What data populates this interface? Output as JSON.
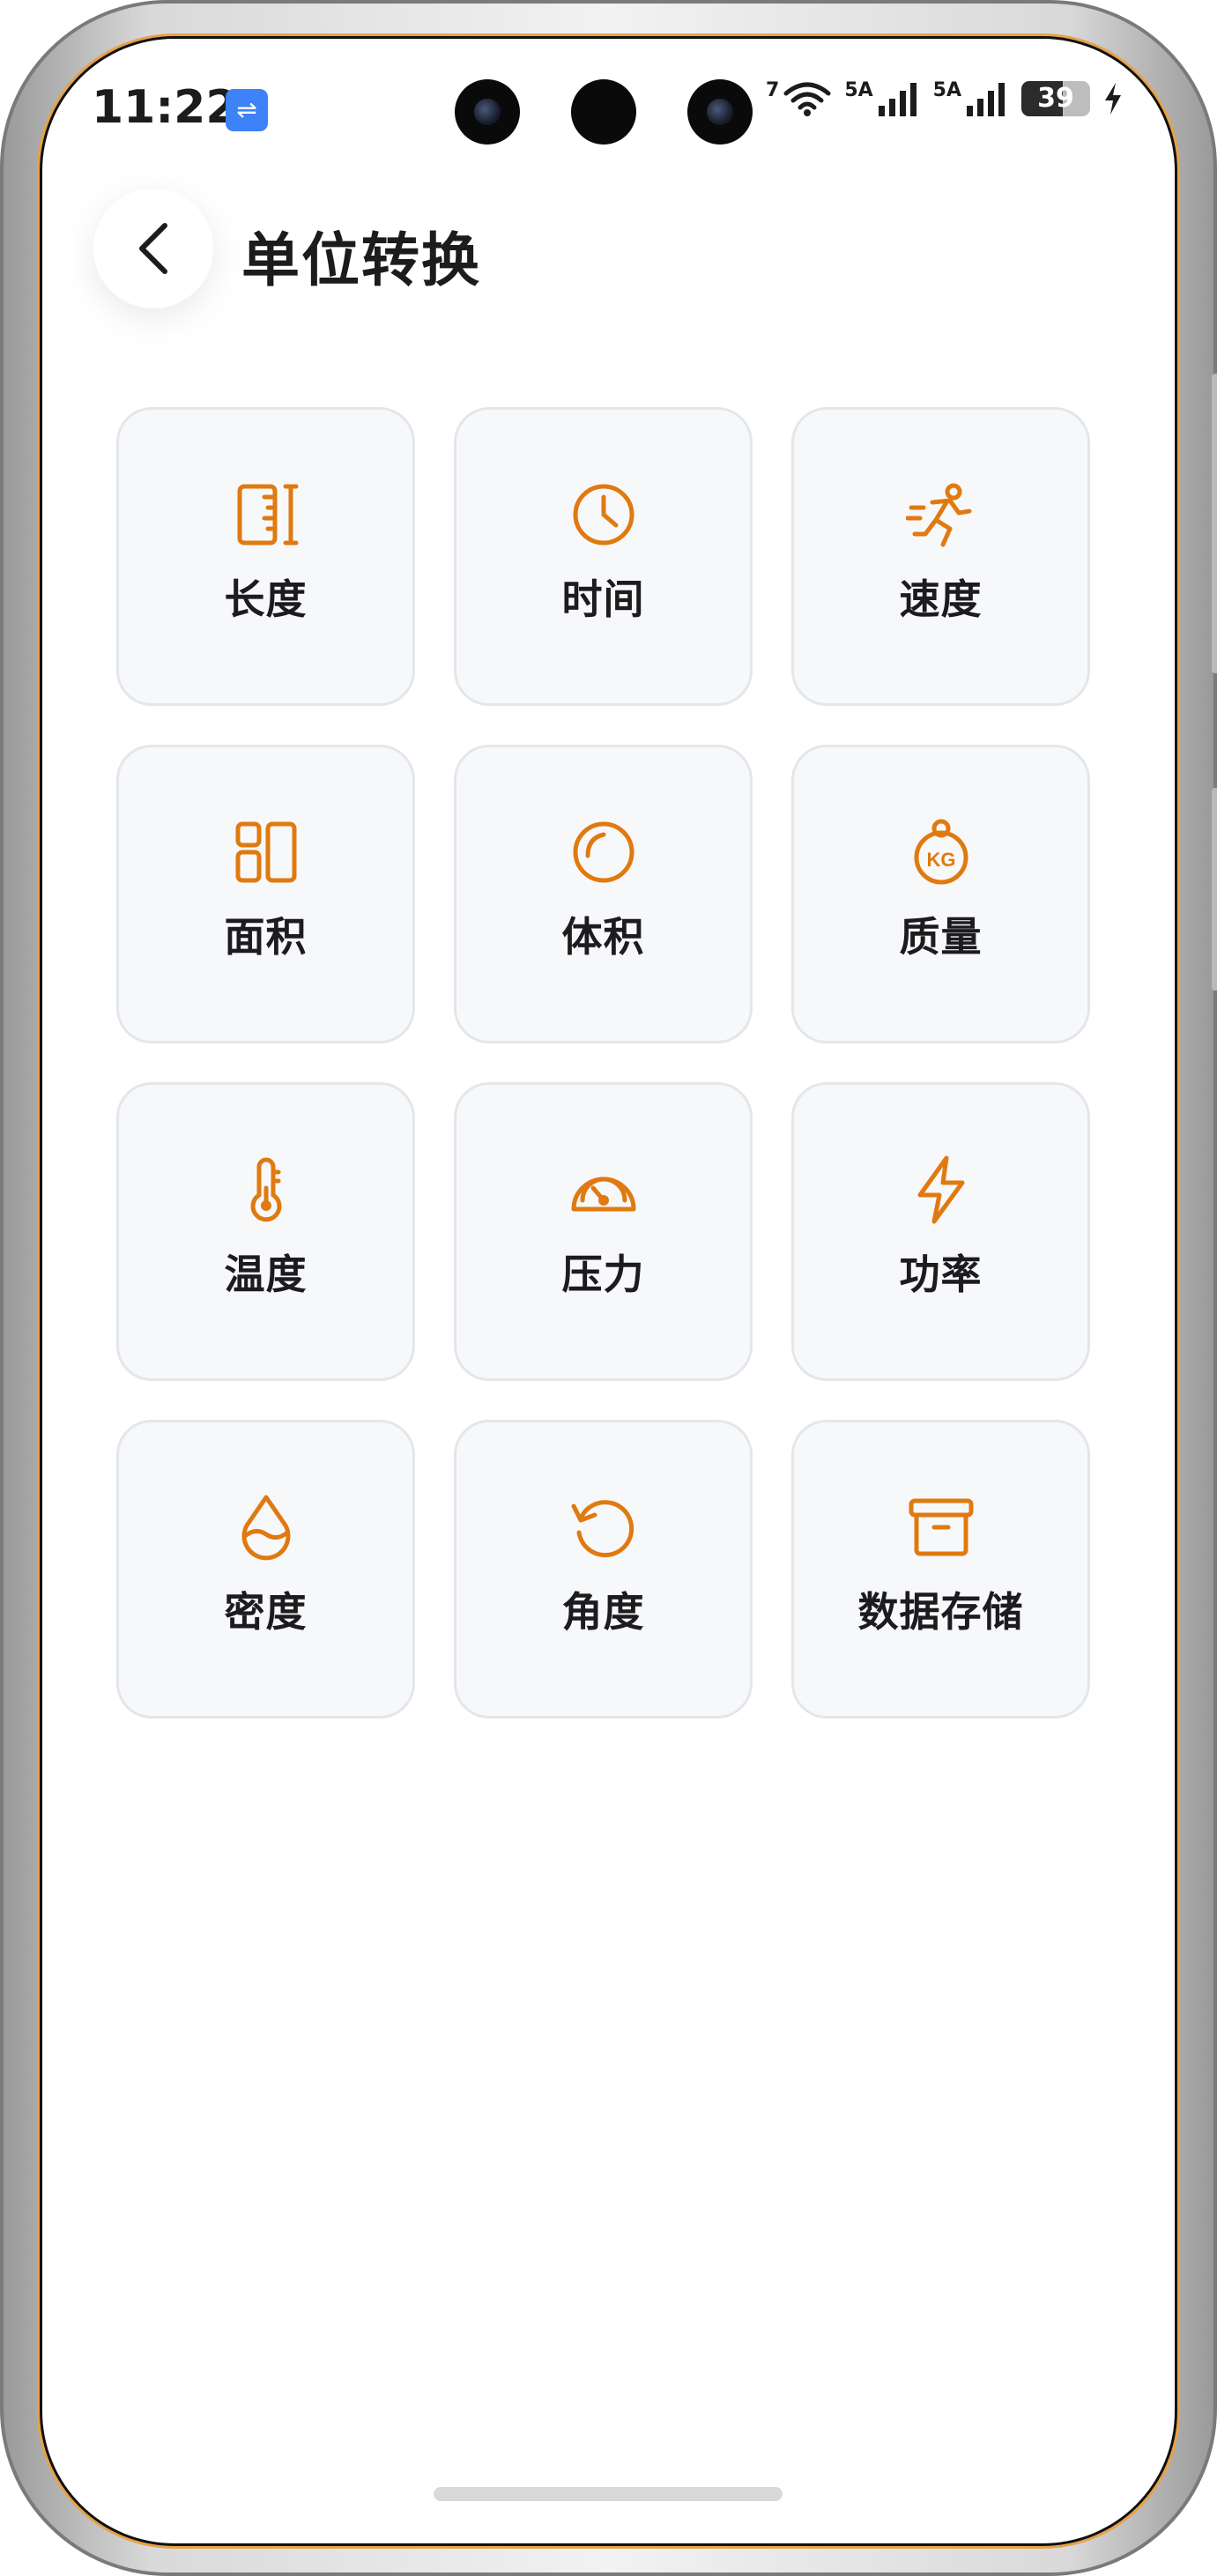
{
  "status_bar": {
    "time": "11:22",
    "usb_icon": "usb-icon",
    "network_tag": "7",
    "signal_1_tag": "5A",
    "signal_2_tag": "5A",
    "battery_level": "39"
  },
  "header": {
    "title": "单位转换",
    "back_icon": "chevron-left-icon"
  },
  "accent_color": "#e07a10",
  "tiles": [
    {
      "label": "长度",
      "icon": "ruler-icon"
    },
    {
      "label": "时间",
      "icon": "clock-icon"
    },
    {
      "label": "速度",
      "icon": "running-icon"
    },
    {
      "label": "面积",
      "icon": "layout-icon"
    },
    {
      "label": "体积",
      "icon": "circle-icon"
    },
    {
      "label": "质量",
      "icon": "weight-kg-icon",
      "icon_text": "KG"
    },
    {
      "label": "温度",
      "icon": "thermometer-icon"
    },
    {
      "label": "压力",
      "icon": "gauge-icon"
    },
    {
      "label": "功率",
      "icon": "lightning-icon"
    },
    {
      "label": "密度",
      "icon": "drop-icon"
    },
    {
      "label": "角度",
      "icon": "rotate-icon"
    },
    {
      "label": "数据存储",
      "icon": "box-icon"
    }
  ]
}
